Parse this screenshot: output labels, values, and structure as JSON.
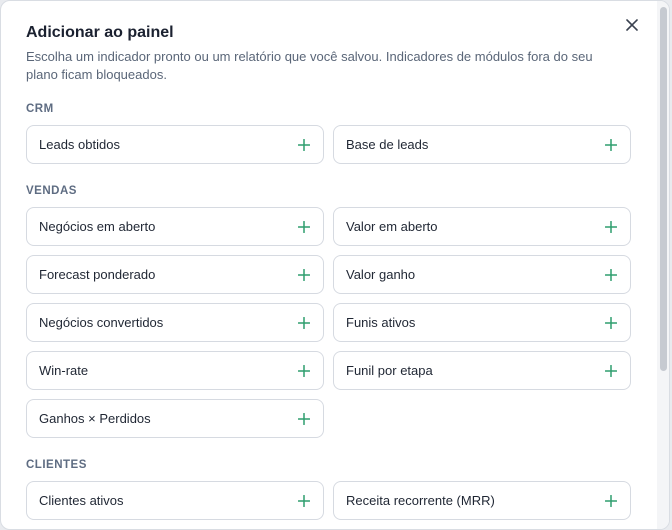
{
  "dialog": {
    "title": "Adicionar ao painel",
    "subtitle": "Escolha um indicador pronto ou um relatório que você salvou. Indicadores de módulos fora do seu plano ficam bloqueados.",
    "close_icon": "close-icon",
    "accent_color": "#2f9e6e"
  },
  "sections": {
    "crm": {
      "label": "CRM",
      "items": [
        "Leads obtidos",
        "Base de leads"
      ]
    },
    "vendas": {
      "label": "VENDAS",
      "items": [
        "Negócios em aberto",
        "Valor em aberto",
        "Forecast ponderado",
        "Valor ganho",
        "Negócios convertidos",
        "Funis ativos",
        "Win-rate",
        "Funil por etapa",
        "Ganhos × Perdidos"
      ]
    },
    "clientes": {
      "label": "CLIENTES",
      "items": [
        "Clientes ativos",
        "Receita recorrente (MRR)"
      ]
    }
  },
  "item_icon": "plus-icon"
}
